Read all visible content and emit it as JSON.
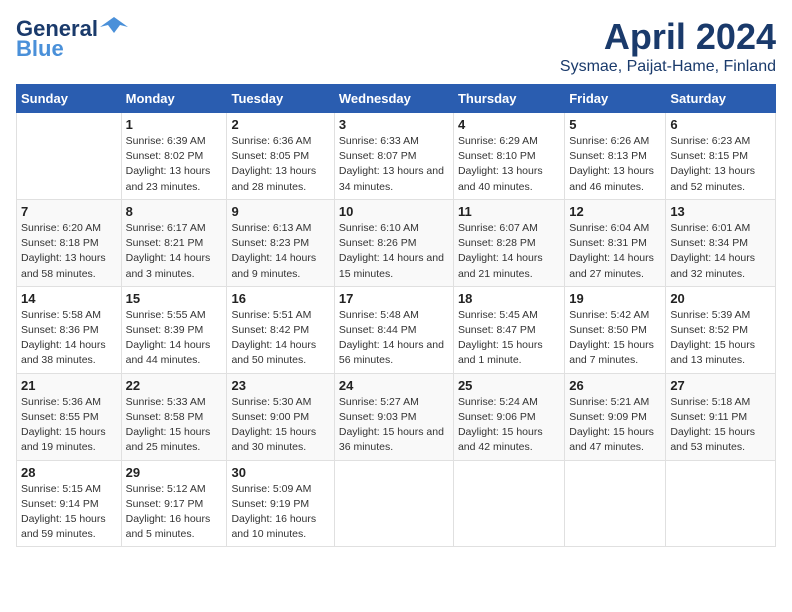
{
  "logo": {
    "line1": "General",
    "line2": "Blue"
  },
  "title": "April 2024",
  "location": "Sysmae, Paijat-Hame, Finland",
  "weekdays": [
    "Sunday",
    "Monday",
    "Tuesday",
    "Wednesday",
    "Thursday",
    "Friday",
    "Saturday"
  ],
  "weeks": [
    [
      {
        "day": "",
        "sunrise": "",
        "sunset": "",
        "daylight": ""
      },
      {
        "day": "1",
        "sunrise": "Sunrise: 6:39 AM",
        "sunset": "Sunset: 8:02 PM",
        "daylight": "Daylight: 13 hours and 23 minutes."
      },
      {
        "day": "2",
        "sunrise": "Sunrise: 6:36 AM",
        "sunset": "Sunset: 8:05 PM",
        "daylight": "Daylight: 13 hours and 28 minutes."
      },
      {
        "day": "3",
        "sunrise": "Sunrise: 6:33 AM",
        "sunset": "Sunset: 8:07 PM",
        "daylight": "Daylight: 13 hours and 34 minutes."
      },
      {
        "day": "4",
        "sunrise": "Sunrise: 6:29 AM",
        "sunset": "Sunset: 8:10 PM",
        "daylight": "Daylight: 13 hours and 40 minutes."
      },
      {
        "day": "5",
        "sunrise": "Sunrise: 6:26 AM",
        "sunset": "Sunset: 8:13 PM",
        "daylight": "Daylight: 13 hours and 46 minutes."
      },
      {
        "day": "6",
        "sunrise": "Sunrise: 6:23 AM",
        "sunset": "Sunset: 8:15 PM",
        "daylight": "Daylight: 13 hours and 52 minutes."
      }
    ],
    [
      {
        "day": "7",
        "sunrise": "Sunrise: 6:20 AM",
        "sunset": "Sunset: 8:18 PM",
        "daylight": "Daylight: 13 hours and 58 minutes."
      },
      {
        "day": "8",
        "sunrise": "Sunrise: 6:17 AM",
        "sunset": "Sunset: 8:21 PM",
        "daylight": "Daylight: 14 hours and 3 minutes."
      },
      {
        "day": "9",
        "sunrise": "Sunrise: 6:13 AM",
        "sunset": "Sunset: 8:23 PM",
        "daylight": "Daylight: 14 hours and 9 minutes."
      },
      {
        "day": "10",
        "sunrise": "Sunrise: 6:10 AM",
        "sunset": "Sunset: 8:26 PM",
        "daylight": "Daylight: 14 hours and 15 minutes."
      },
      {
        "day": "11",
        "sunrise": "Sunrise: 6:07 AM",
        "sunset": "Sunset: 8:28 PM",
        "daylight": "Daylight: 14 hours and 21 minutes."
      },
      {
        "day": "12",
        "sunrise": "Sunrise: 6:04 AM",
        "sunset": "Sunset: 8:31 PM",
        "daylight": "Daylight: 14 hours and 27 minutes."
      },
      {
        "day": "13",
        "sunrise": "Sunrise: 6:01 AM",
        "sunset": "Sunset: 8:34 PM",
        "daylight": "Daylight: 14 hours and 32 minutes."
      }
    ],
    [
      {
        "day": "14",
        "sunrise": "Sunrise: 5:58 AM",
        "sunset": "Sunset: 8:36 PM",
        "daylight": "Daylight: 14 hours and 38 minutes."
      },
      {
        "day": "15",
        "sunrise": "Sunrise: 5:55 AM",
        "sunset": "Sunset: 8:39 PM",
        "daylight": "Daylight: 14 hours and 44 minutes."
      },
      {
        "day": "16",
        "sunrise": "Sunrise: 5:51 AM",
        "sunset": "Sunset: 8:42 PM",
        "daylight": "Daylight: 14 hours and 50 minutes."
      },
      {
        "day": "17",
        "sunrise": "Sunrise: 5:48 AM",
        "sunset": "Sunset: 8:44 PM",
        "daylight": "Daylight: 14 hours and 56 minutes."
      },
      {
        "day": "18",
        "sunrise": "Sunrise: 5:45 AM",
        "sunset": "Sunset: 8:47 PM",
        "daylight": "Daylight: 15 hours and 1 minute."
      },
      {
        "day": "19",
        "sunrise": "Sunrise: 5:42 AM",
        "sunset": "Sunset: 8:50 PM",
        "daylight": "Daylight: 15 hours and 7 minutes."
      },
      {
        "day": "20",
        "sunrise": "Sunrise: 5:39 AM",
        "sunset": "Sunset: 8:52 PM",
        "daylight": "Daylight: 15 hours and 13 minutes."
      }
    ],
    [
      {
        "day": "21",
        "sunrise": "Sunrise: 5:36 AM",
        "sunset": "Sunset: 8:55 PM",
        "daylight": "Daylight: 15 hours and 19 minutes."
      },
      {
        "day": "22",
        "sunrise": "Sunrise: 5:33 AM",
        "sunset": "Sunset: 8:58 PM",
        "daylight": "Daylight: 15 hours and 25 minutes."
      },
      {
        "day": "23",
        "sunrise": "Sunrise: 5:30 AM",
        "sunset": "Sunset: 9:00 PM",
        "daylight": "Daylight: 15 hours and 30 minutes."
      },
      {
        "day": "24",
        "sunrise": "Sunrise: 5:27 AM",
        "sunset": "Sunset: 9:03 PM",
        "daylight": "Daylight: 15 hours and 36 minutes."
      },
      {
        "day": "25",
        "sunrise": "Sunrise: 5:24 AM",
        "sunset": "Sunset: 9:06 PM",
        "daylight": "Daylight: 15 hours and 42 minutes."
      },
      {
        "day": "26",
        "sunrise": "Sunrise: 5:21 AM",
        "sunset": "Sunset: 9:09 PM",
        "daylight": "Daylight: 15 hours and 47 minutes."
      },
      {
        "day": "27",
        "sunrise": "Sunrise: 5:18 AM",
        "sunset": "Sunset: 9:11 PM",
        "daylight": "Daylight: 15 hours and 53 minutes."
      }
    ],
    [
      {
        "day": "28",
        "sunrise": "Sunrise: 5:15 AM",
        "sunset": "Sunset: 9:14 PM",
        "daylight": "Daylight: 15 hours and 59 minutes."
      },
      {
        "day": "29",
        "sunrise": "Sunrise: 5:12 AM",
        "sunset": "Sunset: 9:17 PM",
        "daylight": "Daylight: 16 hours and 5 minutes."
      },
      {
        "day": "30",
        "sunrise": "Sunrise: 5:09 AM",
        "sunset": "Sunset: 9:19 PM",
        "daylight": "Daylight: 16 hours and 10 minutes."
      },
      {
        "day": "",
        "sunrise": "",
        "sunset": "",
        "daylight": ""
      },
      {
        "day": "",
        "sunrise": "",
        "sunset": "",
        "daylight": ""
      },
      {
        "day": "",
        "sunrise": "",
        "sunset": "",
        "daylight": ""
      },
      {
        "day": "",
        "sunrise": "",
        "sunset": "",
        "daylight": ""
      }
    ]
  ]
}
